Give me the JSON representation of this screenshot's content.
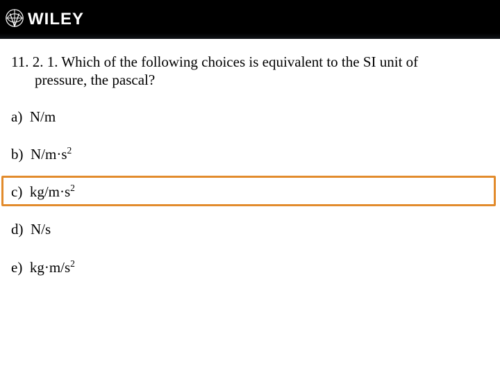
{
  "header": {
    "brand": "WILEY"
  },
  "question": {
    "number": "11. 2. 1.",
    "text_line1": "Which of the following choices is equivalent to the SI unit of",
    "text_line2": "pressure, the pascal?"
  },
  "choices": [
    {
      "letter": "a)",
      "text": "N/m",
      "sup": "",
      "highlight": false
    },
    {
      "letter": "b)",
      "text": "N/m·s",
      "sup": "2",
      "highlight": false
    },
    {
      "letter": "c)",
      "text": "kg/m·s",
      "sup": "2",
      "highlight": true
    },
    {
      "letter": "d)",
      "text": "N/s",
      "sup": "",
      "highlight": false
    },
    {
      "letter": "e)",
      "text": "kg·m/s",
      "sup": "2",
      "highlight": false
    }
  ],
  "colors": {
    "highlight": "#e28b2c",
    "header_bg": "#000000"
  }
}
